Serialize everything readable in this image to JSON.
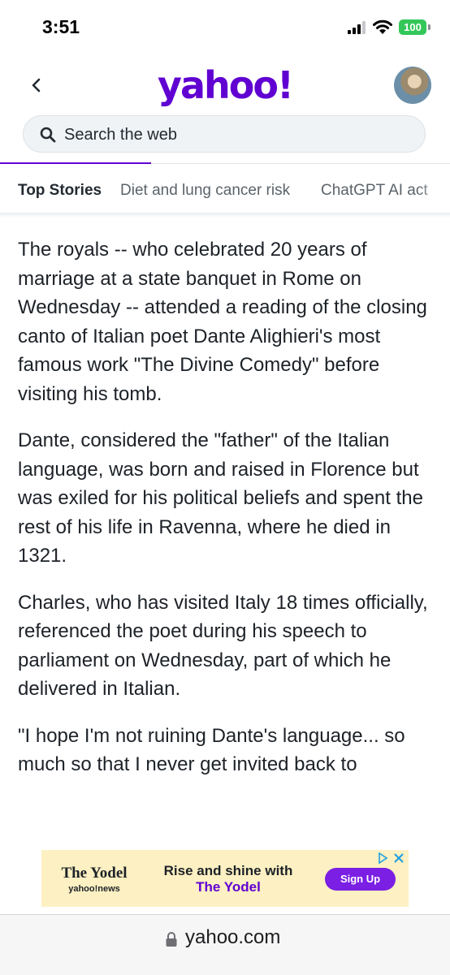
{
  "status_bar": {
    "time": "3:51",
    "battery": "100"
  },
  "header": {
    "logo": "yahoo!"
  },
  "search": {
    "placeholder": "Search the web"
  },
  "tabs": [
    {
      "label": "Top Stories",
      "active": true
    },
    {
      "label": "Diet and lung cancer risk",
      "active": false
    },
    {
      "label": "ChatGPT AI act",
      "active": false
    }
  ],
  "article": {
    "paragraphs": [
      "The royals -- who celebrated 20 years of marriage at a state banquet in Rome on Wednesday -- attended a reading of the closing canto of Italian poet Dante Alighieri's most famous work \"The Divine Comedy\" before visiting his tomb.",
      "Dante, considered the \"father\" of the Italian language, was born and raised in Florence but was exiled for his political beliefs and spent the rest of his life in Ravenna, where he died in 1321.",
      "Charles, who has visited Italy 18 times officially, referenced the poet during his speech to parliament on Wednesday, part of which he delivered in Italian.",
      "\"I hope I'm not ruining Dante's language... so much so that I never get invited back to"
    ]
  },
  "ad": {
    "brand_title": "The Yodel",
    "brand_sub": "yahoo!news",
    "headline_line1": "Rise and shine with",
    "headline_line2": "The Yodel",
    "cta": "Sign Up"
  },
  "bottom_bar": {
    "url": "yahoo.com"
  },
  "colors": {
    "brand": "#6001d2",
    "battery": "#33c759",
    "ad_background": "#fdf0c2",
    "ad_button": "#7b1fe4"
  }
}
